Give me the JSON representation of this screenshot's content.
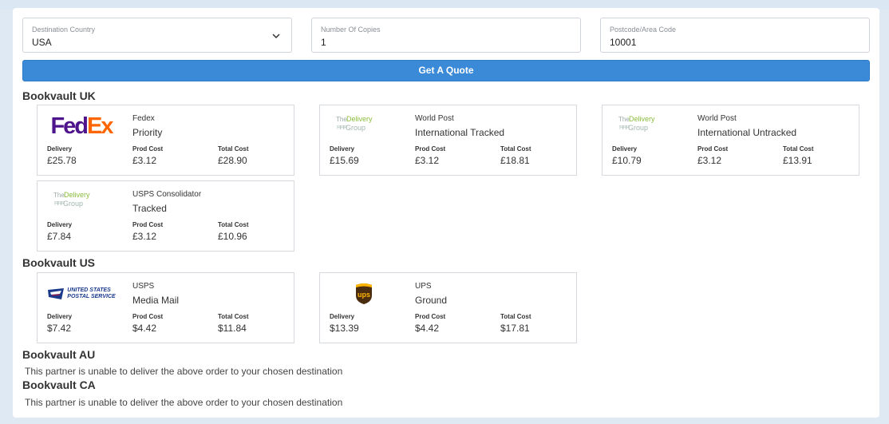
{
  "form": {
    "destination": {
      "label": "Destination Country",
      "value": "USA"
    },
    "copies": {
      "label": "Number Of Copies",
      "value": "1"
    },
    "postcode": {
      "label": "Postcode/Area Code",
      "value": "10001"
    },
    "quote_button": "Get A Quote"
  },
  "col_labels": {
    "delivery": "Delivery",
    "prod": "Prod Cost",
    "total": "Total Cost"
  },
  "logos": {
    "fedex": {
      "fd": "Fed",
      "ex": "Ex",
      "fd_color": "#4d148c",
      "ex_color": "#ff6600"
    },
    "tdg": {
      "the": "The",
      "delivery": "Delivery",
      "group": "Group",
      "people": "ĦĦĦ"
    },
    "usps": {
      "line1": "UNITED STATES",
      "line2": "POSTAL SERVICE"
    },
    "ups": {
      "text": "ups"
    }
  },
  "sections": {
    "uk": {
      "title": "Bookvault UK",
      "quotes": [
        {
          "logo": "fedex-logo",
          "carrier": "Fedex",
          "service": "Priority",
          "delivery": "£25.78",
          "prod": "£3.12",
          "total": "£28.90"
        },
        {
          "logo": "delivery-group-logo",
          "carrier": "World Post",
          "service": "International Tracked",
          "delivery": "£15.69",
          "prod": "£3.12",
          "total": "£18.81"
        },
        {
          "logo": "delivery-group-logo",
          "carrier": "World Post",
          "service": "International Untracked",
          "delivery": "£10.79",
          "prod": "£3.12",
          "total": "£13.91"
        },
        {
          "logo": "delivery-group-logo",
          "carrier": "USPS Consolidator",
          "service": "Tracked",
          "delivery": "£7.84",
          "prod": "£3.12",
          "total": "£10.96"
        }
      ]
    },
    "us": {
      "title": "Bookvault US",
      "quotes": [
        {
          "logo": "usps-logo",
          "carrier": "USPS",
          "service": "Media Mail",
          "delivery": "$7.42",
          "prod": "$4.42",
          "total": "$11.84"
        },
        {
          "logo": "ups-logo",
          "carrier": "UPS",
          "service": "Ground",
          "delivery": "$13.39",
          "prod": "$4.42",
          "total": "$17.81"
        }
      ]
    },
    "au": {
      "title": "Bookvault AU",
      "message": "This partner is unable to deliver the above order to your chosen destination"
    },
    "ca": {
      "title": "Bookvault CA",
      "message": "This partner is unable to deliver the above order to your chosen destination"
    }
  },
  "colors": {
    "accent": "#3a8ad8",
    "border": "#d6dade",
    "text": "#333333"
  }
}
